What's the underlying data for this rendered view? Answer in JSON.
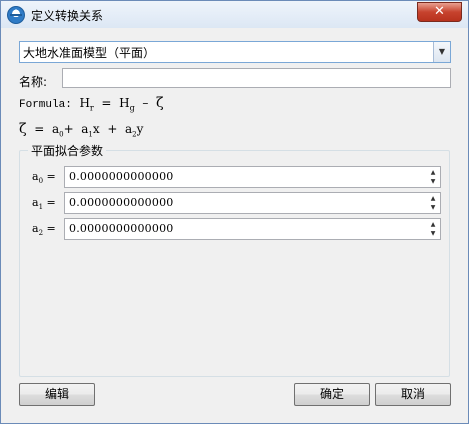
{
  "window": {
    "title": "定义转换关系",
    "close_symbol": "✕"
  },
  "model_select": {
    "selected": "大地水准面模型（平面）",
    "arrow": "▼"
  },
  "name_field": {
    "label": "名称:",
    "value": ""
  },
  "formula": {
    "label": "Formula:",
    "expr_left": "H",
    "expr_left_sub": "r",
    "equals": "=",
    "expr_mid": "H",
    "expr_mid_sub": "g",
    "minus": "–",
    "zeta": "ζ"
  },
  "zeta_formula": {
    "zeta": "ζ",
    "equals": "=",
    "a0": "a",
    "a0_sub": "0",
    "plus1": "+",
    "a1": "a",
    "a1_sub": "1",
    "x": "x",
    "plus2": "+",
    "a2": "a",
    "a2_sub": "2",
    "y": "y"
  },
  "params_group": {
    "title": "平面拟合参数",
    "params": [
      {
        "label": "a",
        "sub": "0",
        "eq": " =",
        "value": "0.0000000000000"
      },
      {
        "label": "a",
        "sub": "1",
        "eq": " =",
        "value": "0.0000000000000"
      },
      {
        "label": "a",
        "sub": "2",
        "eq": " =",
        "value": "0.0000000000000"
      }
    ]
  },
  "buttons": {
    "edit": "编辑",
    "ok": "确定",
    "cancel": "取消"
  }
}
